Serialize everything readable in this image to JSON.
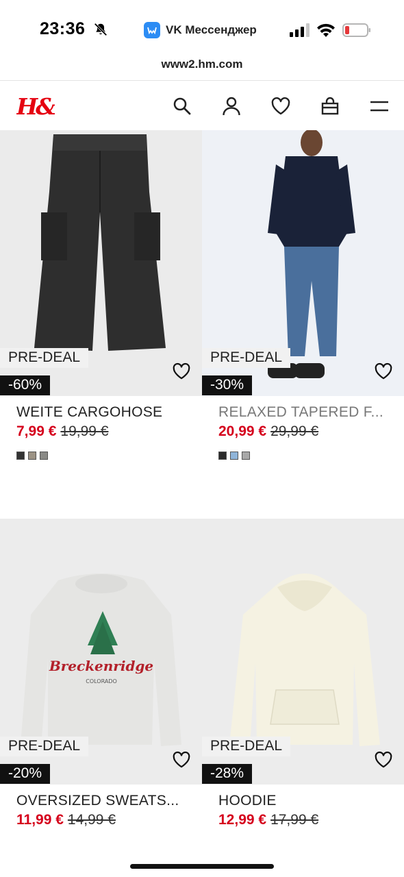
{
  "status_bar": {
    "time": "23:36",
    "app_name": "VK Мессенджер",
    "battery_color": "#e5383b"
  },
  "browser": {
    "url": "www2.hm.com"
  },
  "header": {
    "logo_text": "H&M",
    "logo_color": "#e50010",
    "icons": [
      "search-icon",
      "account-icon",
      "favorites-icon",
      "cart-icon",
      "menu-icon"
    ]
  },
  "products": [
    {
      "badge": "PRE-DEAL",
      "discount": "-60%",
      "name": "WEITE CARGOHOSE",
      "sale_price": "7,99 €",
      "original_price": "19,99 €",
      "swatches": [
        "#333333",
        "#9c9385",
        "#8a8a86"
      ]
    },
    {
      "badge": "PRE-DEAL",
      "discount": "-30%",
      "name": "RELAXED TAPERED F...",
      "sale_price": "20,99 €",
      "original_price": "29,99 €",
      "swatches": [
        "#2b2b2b",
        "#8fb4d8",
        "#a8a8a8"
      ]
    },
    {
      "badge": "PRE-DEAL",
      "discount": "-20%",
      "name": "OVERSIZED SWEATS...",
      "sale_price": "11,99 €",
      "original_price": "14,99 €",
      "swatches": []
    },
    {
      "badge": "PRE-DEAL",
      "discount": "-28%",
      "name": "HOODIE",
      "sale_price": "12,99 €",
      "original_price": "17,99 €",
      "swatches": []
    }
  ],
  "product_art": {
    "sweatshirt_print": "Breckenridge",
    "sweatshirt_subprint": "COLORADO"
  },
  "colors": {
    "sale_red": "#d5001c",
    "discount_badge_bg": "#111111",
    "deal_badge_bg": "#f1f1f1",
    "image_bg": "#ececec"
  }
}
